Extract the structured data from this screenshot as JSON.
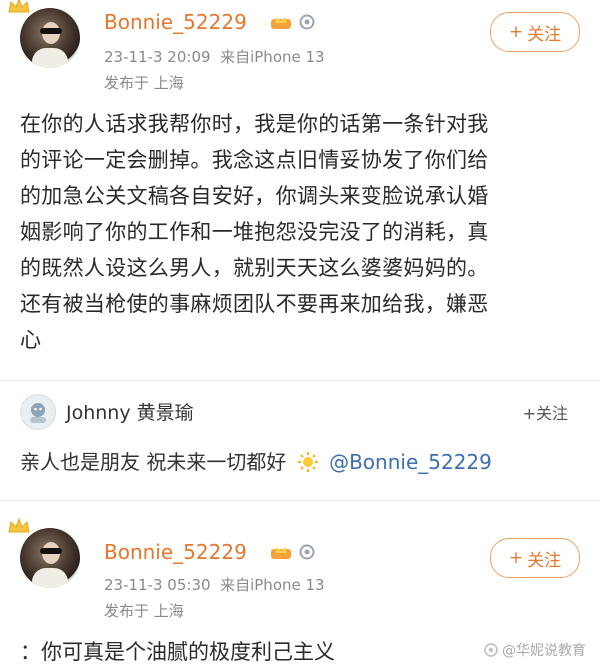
{
  "post1": {
    "username": "Bonnie_52229",
    "timestamp": "23-11-3 20:09",
    "source": "来自iPhone 13",
    "location": "发布于 上海",
    "follow_label": "关注",
    "text_lines": [
      "在你的人话求我帮你时，我是你的话第一条针对我",
      "的评论一定会删掉。我念这点旧情妥协发了你们给",
      "的加急公关文稿各自安好，你调头来变脸说承认婚",
      "姻影响了你的工作和一堆抱怨没完没了的消耗，真",
      "的既然人设这么男人，就别天天这么婆婆妈妈的。",
      "还有被当枪使的事麻烦团队不要再来加给我，嫌恶",
      "心"
    ]
  },
  "reply": {
    "username": "Johnny 黄景瑜",
    "follow_label": "关注",
    "text": "亲人也是朋友 祝未来一切都好",
    "mention": "@Bonnie_52229"
  },
  "post2": {
    "username": "Bonnie_52229",
    "timestamp": "23-11-3 05:30",
    "source": "来自iPhone 13",
    "location": "发布于 上海",
    "follow_label": "关注",
    "text": "：你可真是个油腻的极度利己主义"
  },
  "watermark": "@华妮说教育",
  "colors": {
    "username": "#e4772d",
    "follow": "#e47a2d",
    "mention": "#3b6fb0"
  }
}
